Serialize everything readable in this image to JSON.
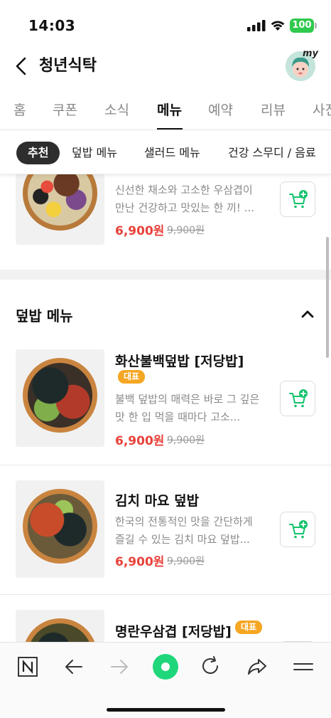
{
  "status_bar": {
    "time": "14:03",
    "battery": "100"
  },
  "header": {
    "title": "청년식탁",
    "avatar_badge": "my"
  },
  "tabs": [
    {
      "label": "홈"
    },
    {
      "label": "쿠폰"
    },
    {
      "label": "소식"
    },
    {
      "label": "메뉴",
      "active": true
    },
    {
      "label": "예약"
    },
    {
      "label": "리뷰"
    },
    {
      "label": "사진"
    }
  ],
  "chips": [
    {
      "label": "추천",
      "active": true
    },
    {
      "label": "덮밥 메뉴"
    },
    {
      "label": "샐러드 메뉴"
    },
    {
      "label": "건강 스무디 / 음료"
    }
  ],
  "partial_item": {
    "desc": "신선한 채소와 고소한 우삼겹이 만난 건강하고 맛있는 한 끼! ...",
    "price": "6,900원",
    "original_price": "9,900원"
  },
  "section": {
    "title": "덮밥 메뉴"
  },
  "items": [
    {
      "name": "화산불백덮밥 [저당밥]",
      "badge": "대표",
      "desc": "불백 덮밥의 매력은 바로 그 깊은 맛 한 입 먹을 때마다 고소...",
      "price": "6,900원",
      "original_price": "9,900원"
    },
    {
      "name": "김치 마요 덮밥",
      "desc": "한국의 전통적인 맛을 간단하게 즐길 수 있는 김치 마요 덮밥...",
      "price": "6,900원",
      "original_price": "9,900원"
    },
    {
      "name": "명란우삼겹 [저당밥]",
      "badge": "대표"
    }
  ],
  "colors": {
    "price": "#e8423a",
    "badge": "#f5a623",
    "cart_icon": "#12c26b",
    "battery": "#2fc94d"
  },
  "bottom_bar": {
    "icons": [
      "naver-n-icon",
      "back-arrow-icon",
      "forward-arrow-icon",
      "green-dot-home-icon",
      "refresh-icon",
      "share-icon",
      "menu-icon"
    ]
  }
}
